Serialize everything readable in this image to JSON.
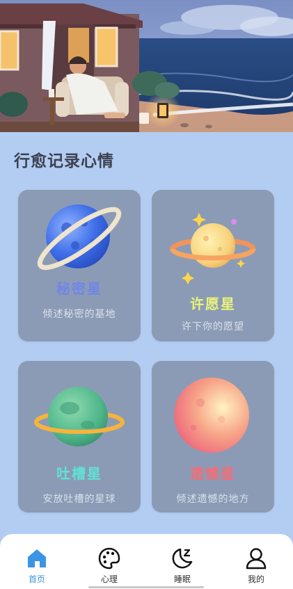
{
  "section_title": "行愈记录心情",
  "cards": [
    {
      "name": "秘密星",
      "desc": "倾述秘密的基地",
      "name_color": "#6f86e8"
    },
    {
      "name": "许愿星",
      "desc": "许下你的愿望",
      "name_color": "#e9f27a"
    },
    {
      "name": "吐槽星",
      "desc": "安放吐槽的星球",
      "name_color": "#5fe3d6"
    },
    {
      "name": "遗憾星",
      "desc": "倾述遗憾的地方",
      "name_color": "#f36d78"
    }
  ],
  "tabbar": {
    "home": "首页",
    "psychology": "心理",
    "sleep": "睡眠",
    "mine": "我的"
  },
  "colors": {
    "background": "#b3cdf2",
    "card": "#8c9bb5",
    "accent": "#3b95e6"
  }
}
